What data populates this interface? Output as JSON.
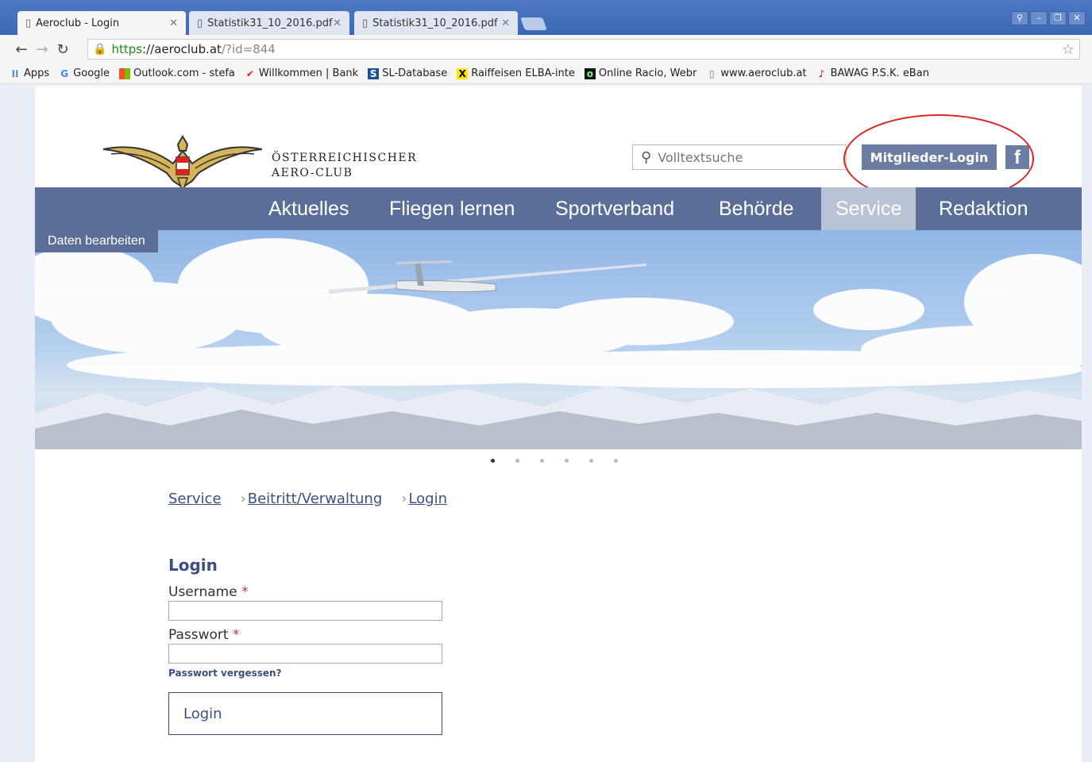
{
  "browser": {
    "tabs": [
      {
        "label": "Aeroclub - Login",
        "active": true
      },
      {
        "label": "Statistik31_10_2016.pdf",
        "active": false
      },
      {
        "label": "Statistik31_10_2016.pdf",
        "active": false
      }
    ],
    "url": {
      "scheme": "https",
      "host": "://aeroclub.at",
      "path": "/?id=844"
    },
    "bookmarks": [
      {
        "label": "Apps",
        "icon": "apps-grid-icon"
      },
      {
        "label": "Google",
        "icon": "google-icon"
      },
      {
        "label": "Outlook.com - stefa",
        "icon": "outlook-icon"
      },
      {
        "label": "Willkommen | Bank",
        "icon": "bank-icon"
      },
      {
        "label": "SL-Database",
        "icon": "database-icon"
      },
      {
        "label": "Raiffeisen ELBA-inte",
        "icon": "raiffeisen-icon"
      },
      {
        "label": "Online Racio, Webr",
        "icon": "racio-icon"
      },
      {
        "label": "www.aeroclub.at",
        "icon": "page-icon"
      },
      {
        "label": "BAWAG P.S.K. eBan",
        "icon": "bawag-icon"
      }
    ]
  },
  "site": {
    "brand_line1": "ÖSTERREICHISCHER",
    "brand_line2": "AERO-CLUB",
    "search_placeholder": "Volltextsuche",
    "member_login": "Mitglieder-Login",
    "facebook": "f",
    "nav": [
      "Aktuelles",
      "Fliegen lernen",
      "Sportverband",
      "Behörde",
      "Service",
      "Redaktion"
    ],
    "active_nav": "Service",
    "edit_tag": "Daten bearbeiten",
    "slider_count": 6,
    "slider_active": 1
  },
  "breadcrumb": [
    "Service",
    "Beitritt/Verwaltung",
    "Login"
  ],
  "login": {
    "title": "Login",
    "username_label": "Username",
    "password_label": "Passwort",
    "required_mark": "*",
    "forgot": "Passwort vergessen?",
    "submit": "Login"
  }
}
